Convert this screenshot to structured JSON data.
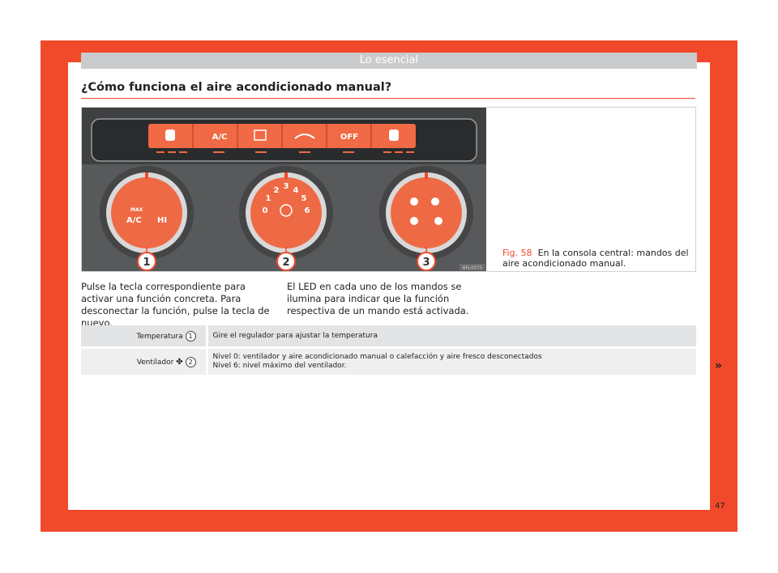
{
  "header": {
    "section": "Lo esencial"
  },
  "page": {
    "title": "¿Cómo funciona el aire acondicionado manual?",
    "number": "47",
    "next_marker": "»"
  },
  "figure": {
    "label": "Fig. 58",
    "caption": "En la consola central: mandos del aire acondicionado manual.",
    "ref_code": "BFJ-0075",
    "buttons": [
      "A/C",
      "OFF"
    ],
    "dial1": {
      "max": "MAX",
      "ac": "A/C",
      "hi": "HI"
    },
    "dial2": {
      "levels": [
        "0",
        "1",
        "2",
        "3",
        "4",
        "5",
        "6"
      ]
    },
    "callouts": [
      "1",
      "2",
      "3"
    ]
  },
  "body": {
    "col1": "Pulse la tecla correspondiente para activar una función concreta. Para desconectar la función, pulse la tecla de nuevo.",
    "col2": "El LED en cada uno de los mandos se ilumina para indicar que la función respectiva de un mando está activada."
  },
  "table": {
    "rows": [
      {
        "label": "Temperatura",
        "ref": "1",
        "text1": "Gire el regulador para ajustar la temperatura",
        "text2": ""
      },
      {
        "label": "Ventilador",
        "icon": "fan-icon",
        "ref": "2",
        "text1": "Nivel 0: ventilador y aire acondicionado manual o calefacción y aire fresco desconectados",
        "text2": "Nivel 6: nivel máximo del ventilador."
      }
    ]
  },
  "colors": {
    "accent": "#f04a2a",
    "header_bg": "#c9cbcd",
    "panel": "#565758",
    "knob": "#ee6a45"
  }
}
